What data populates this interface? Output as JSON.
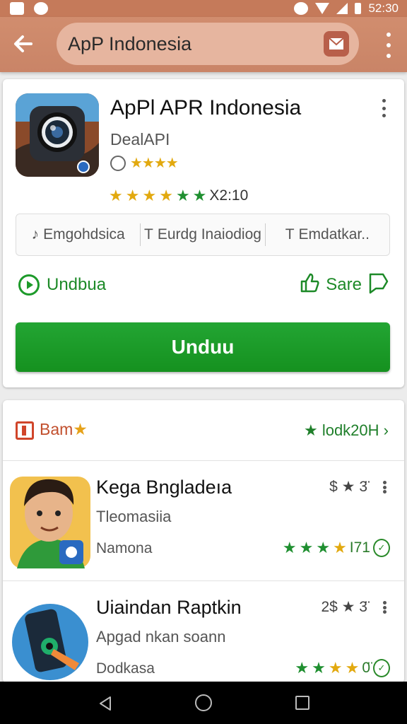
{
  "status_bar": {
    "time": "52:30"
  },
  "search": {
    "query": "ApP Indonesia"
  },
  "app": {
    "title": "ApPl APR Indonesia",
    "developer": "DealAPI",
    "rating_count": "X2:10",
    "info_items": [
      {
        "icon": "music-note-icon",
        "label": "Emgohdsica"
      },
      {
        "icon": "tag-icon",
        "label": "Eurdg Inaiodiog"
      },
      {
        "icon": "tag-icon",
        "label": "Emdatkar.."
      }
    ],
    "action_left_label": "Undbua",
    "action_right_label": "Sare",
    "install_label": "Unduu"
  },
  "list": {
    "header_title": "Bam",
    "header_link": "lodk20H",
    "items": [
      {
        "title": "Kega Bngladeıa",
        "subtitle": "Tleomasiia",
        "meta": "Namona",
        "price": "$ ★ 3̈̈",
        "rating_count": "I71",
        "thumb_icon": "cartoon-man-icon"
      },
      {
        "title": "Uiaindan Raptkin",
        "subtitle": "Apgad nkan soann",
        "meta": "Dodkasa",
        "price": "2$ ★ 3̈̈",
        "rating_count": "0̈",
        "thumb_icon": "phone-tap-icon"
      }
    ]
  },
  "colors": {
    "app_bar": "#c98467",
    "install_button": "#1d9a2a",
    "accent_green": "#1d8a28",
    "accent_orange": "#c2502e",
    "star_gold": "#e2a90f"
  }
}
